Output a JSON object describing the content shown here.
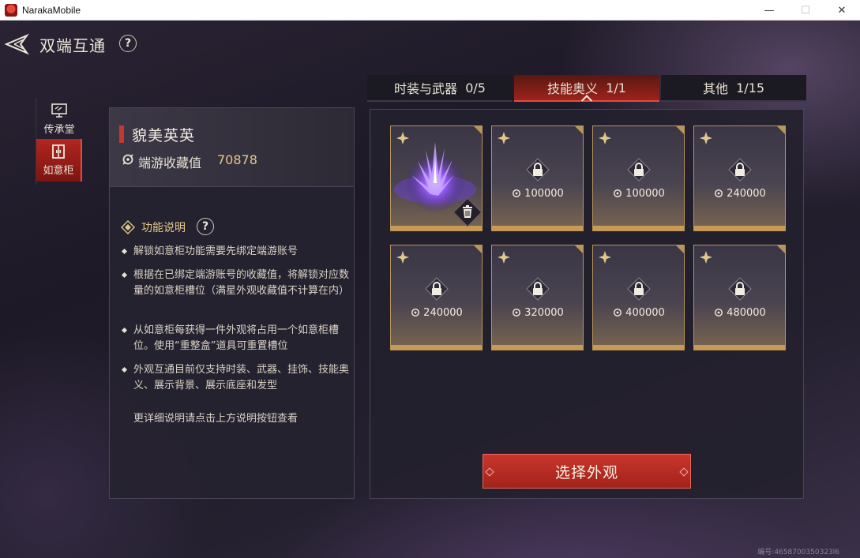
{
  "window": {
    "title": "NarakaMobile"
  },
  "header": {
    "title": "双端互通",
    "help": "?"
  },
  "nav": [
    {
      "label": "传承堂",
      "icon": "monitor-icon",
      "active": false
    },
    {
      "label": "如意柜",
      "icon": "cabinet-icon",
      "active": true
    }
  ],
  "info": {
    "player_name": "貌美英英",
    "collection_label": "端游收藏值",
    "collection_value": "70878",
    "func_title": "功能说明",
    "func_help": "?",
    "rules": [
      "解锁如意柜功能需要先绑定端游账号",
      "根据在已绑定端游账号的收藏值，将解锁对应数量的如意柜槽位（满星外观收藏值不计算在内）",
      "从如意柜每获得一件外观将占用一个如意柜槽位。使用“重整盒”道具可重置槽位",
      "外观互通目前仅支持时装、武器、挂饰、技能奥义、展示背景、展示底座和发型"
    ],
    "note": "更详细说明请点击上方说明按钮查看"
  },
  "tabs": [
    {
      "label": "时装与武器",
      "count": "0/5",
      "active": false
    },
    {
      "label": "技能奥义",
      "count": "1/1",
      "active": true
    },
    {
      "label": "其他",
      "count": "1/15",
      "active": false
    }
  ],
  "slots": [
    {
      "state": "filled",
      "cost": ""
    },
    {
      "state": "locked",
      "cost": "100000"
    },
    {
      "state": "locked",
      "cost": "100000"
    },
    {
      "state": "locked",
      "cost": "240000"
    },
    {
      "state": "locked",
      "cost": "240000"
    },
    {
      "state": "locked",
      "cost": "320000"
    },
    {
      "state": "locked",
      "cost": "400000"
    },
    {
      "state": "locked",
      "cost": "480000"
    }
  ],
  "select_button": "选择外观",
  "uid": "编号:4658700350323l6"
}
